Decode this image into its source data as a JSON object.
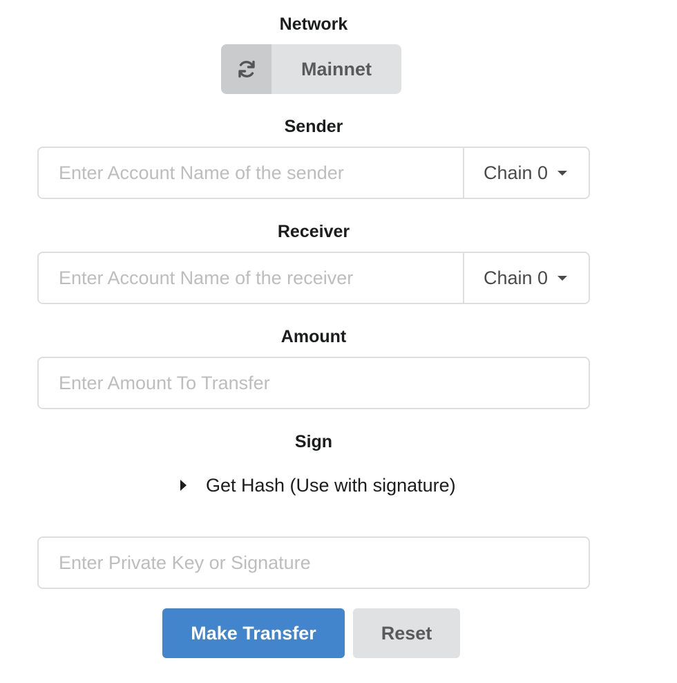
{
  "network": {
    "label": "Network",
    "button_label": "Mainnet",
    "icon": "refresh-icon"
  },
  "sender": {
    "label": "Sender",
    "placeholder": "Enter Account Name of the sender",
    "chain": "Chain 0"
  },
  "receiver": {
    "label": "Receiver",
    "placeholder": "Enter Account Name of the receiver",
    "chain": "Chain 0"
  },
  "amount": {
    "label": "Amount",
    "placeholder": "Enter Amount To Transfer"
  },
  "sign": {
    "label": "Sign",
    "hash_toggle": "Get Hash (Use with signature)",
    "key_placeholder": "Enter Private Key or Signature"
  },
  "actions": {
    "submit": "Make Transfer",
    "reset": "Reset"
  },
  "colors": {
    "primary": "#4285cc",
    "secondary": "#e0e1e2",
    "border": "#dedede",
    "placeholder": "#bdbdbd"
  }
}
